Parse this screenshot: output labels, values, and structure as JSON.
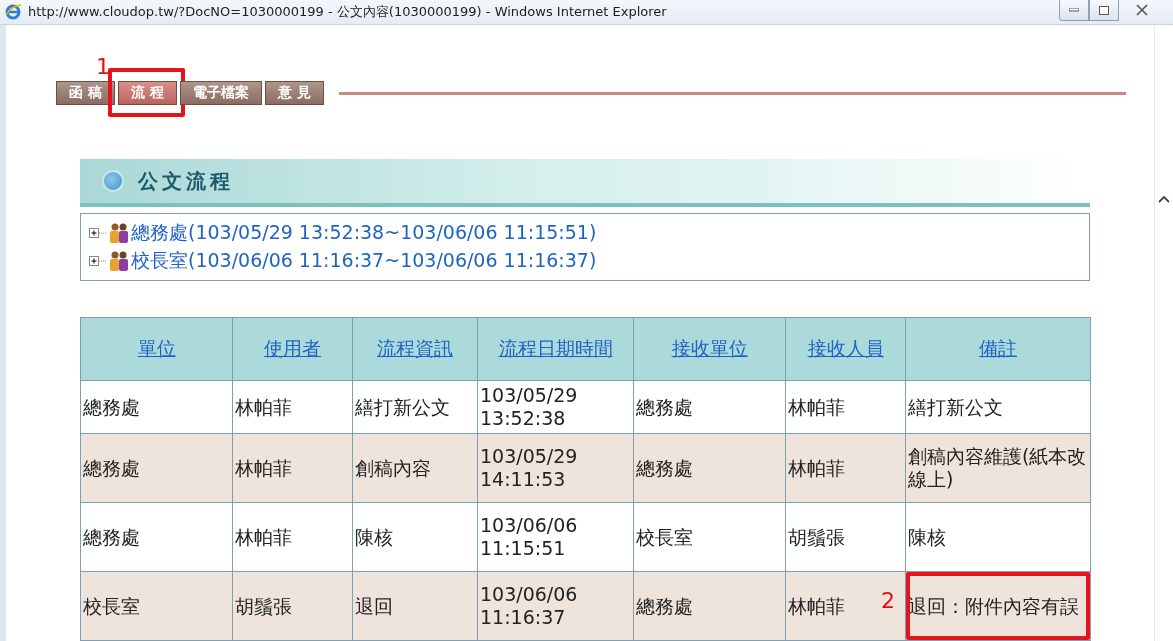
{
  "window": {
    "title": "http://www.cloudop.tw/?DocNO=1030000199 - 公文內容(1030000199) - Windows Internet Explorer"
  },
  "tabs": [
    {
      "label": "函 稿",
      "selected": false
    },
    {
      "label": "流 程",
      "selected": true,
      "callout": "1"
    },
    {
      "label": "電子檔案",
      "selected": false
    },
    {
      "label": "意 見",
      "selected": false
    }
  ],
  "section": {
    "title": "公文流程"
  },
  "tree": [
    {
      "label": "總務處(103/05/29 13:52:38~103/06/06 11:15:51)",
      "expanded": false
    },
    {
      "label": "校長室(103/06/06 11:16:37~103/06/06 11:16:37)",
      "expanded": false
    }
  ],
  "table": {
    "columns": [
      "單位",
      "使用者",
      "流程資訊",
      "流程日期時間",
      "接收單位",
      "接收人員",
      "備註"
    ],
    "rows": [
      {
        "cells": [
          "總務處",
          "林帕菲",
          "繕打新公文",
          "103/05/29 13:52:38",
          "總務處",
          "林帕菲",
          "繕打新公文"
        ]
      },
      {
        "cells": [
          "總務處",
          "林帕菲",
          "創稿內容",
          "103/05/29 14:11:53",
          "總務處",
          "林帕菲",
          "創稿內容維護(紙本改線上)"
        ]
      },
      {
        "cells": [
          "總務處",
          "林帕菲",
          "陳核",
          "103/06/06 11:15:51",
          "校長室",
          "胡鬚張",
          "陳核"
        ]
      },
      {
        "cells": [
          "校長室",
          "胡鬚張",
          "退回",
          "103/06/06 11:16:37",
          "總務處",
          "林帕菲",
          "退回：附件內容有誤"
        ],
        "callout": "2"
      }
    ]
  }
}
